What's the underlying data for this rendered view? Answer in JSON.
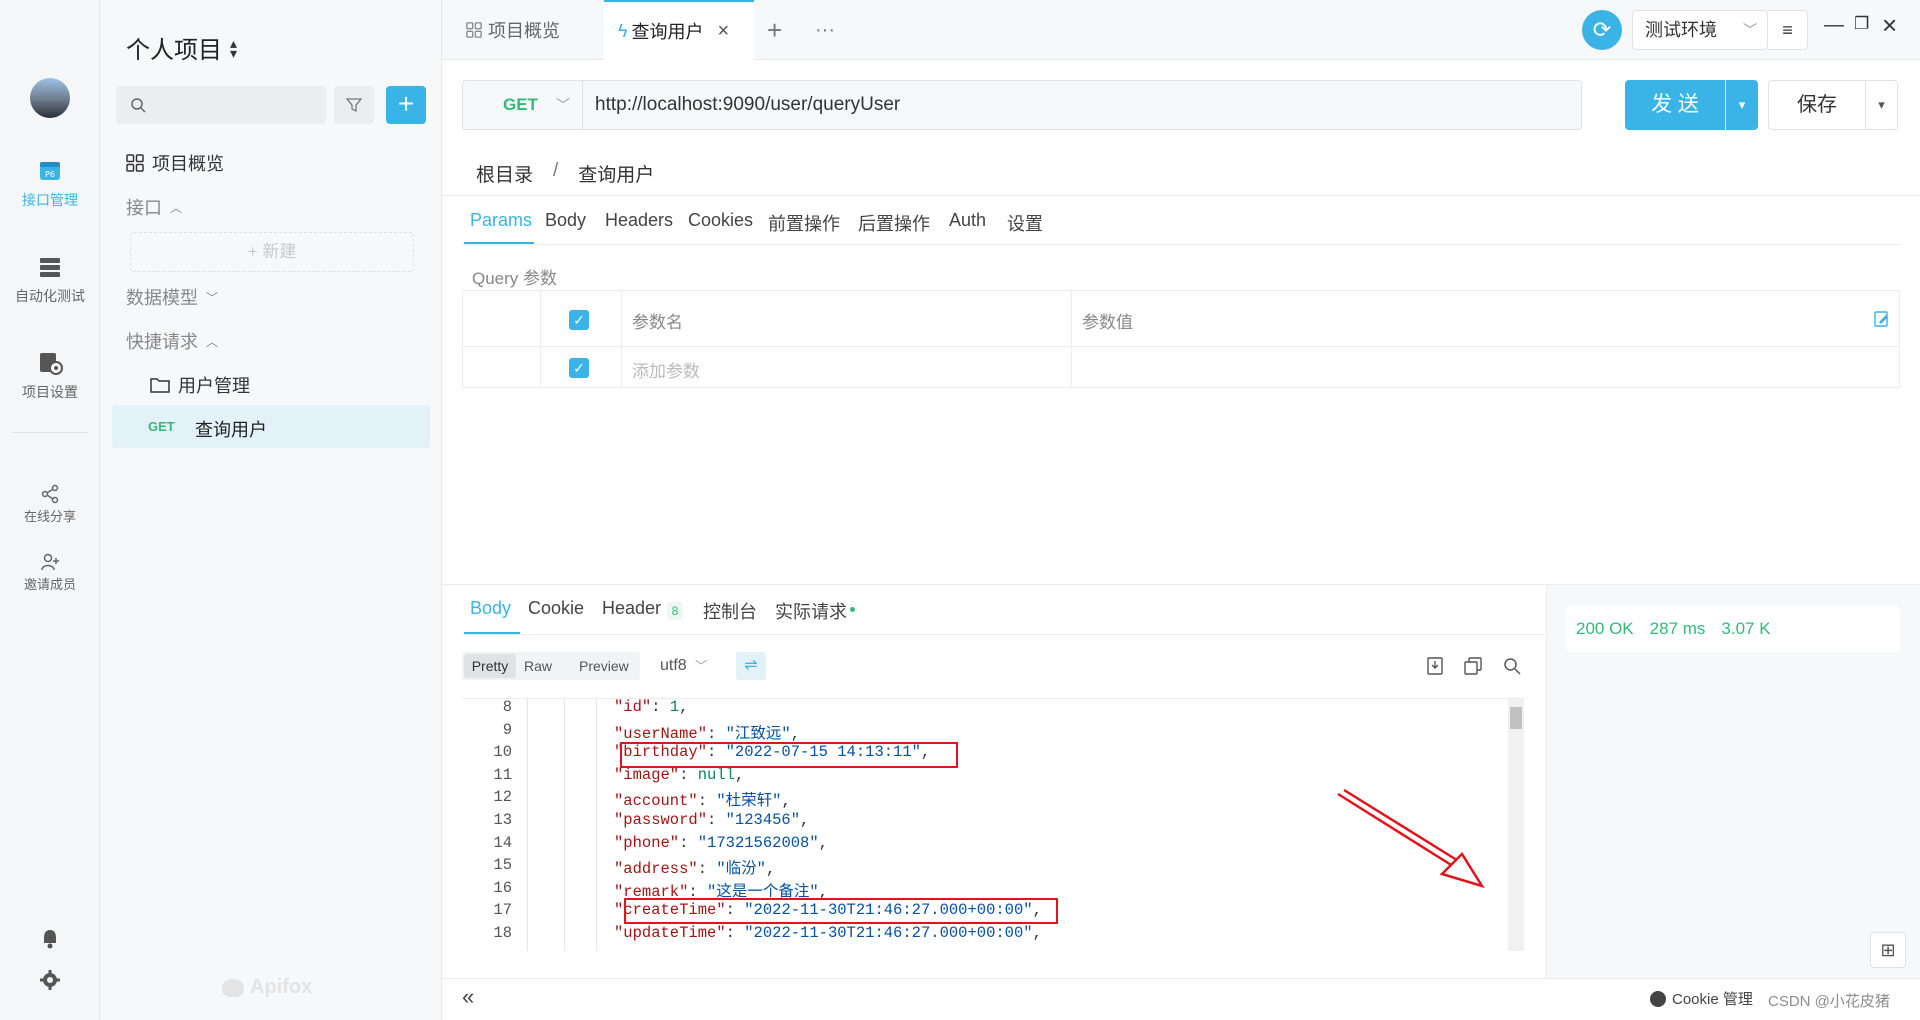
{
  "rail": {
    "items": [
      {
        "label": "接口管理"
      },
      {
        "label": "自动化测试"
      },
      {
        "label": "项目设置"
      },
      {
        "label": "在线分享"
      },
      {
        "label": "邀请成员"
      }
    ]
  },
  "sidebar": {
    "project_title": "个人项目",
    "overview": "项目概览",
    "api_section": "接口",
    "new_label": "+ 新建",
    "data_model": "数据模型",
    "quick_request": "快捷请求",
    "folder": "用户管理",
    "request_method": "GET",
    "request_name": "查询用户",
    "brand": "Apifox"
  },
  "tabs": {
    "overview": "项目概览",
    "active": "查询用户",
    "env": "测试环境"
  },
  "request": {
    "method": "GET",
    "url": "http://localhost:9090/user/queryUser",
    "send": "发 送",
    "save": "保存"
  },
  "breadcrumb": {
    "root": "根目录",
    "sep": "/",
    "current": "查询用户"
  },
  "req_tabs": [
    "Params",
    "Body",
    "Headers",
    "Cookies",
    "前置操作",
    "后置操作",
    "Auth",
    "设置"
  ],
  "query": {
    "title": "Query 参数",
    "col_name": "参数名",
    "col_value": "参数值",
    "add_placeholder": "添加参数"
  },
  "resp_tabs": {
    "body": "Body",
    "cookie": "Cookie",
    "header": "Header",
    "header_count": "8",
    "console": "控制台",
    "actual": "实际请求"
  },
  "resp_view": {
    "pretty": "Pretty",
    "raw": "Raw",
    "preview": "Preview",
    "encoding": "utf8"
  },
  "status": {
    "code": "200 OK",
    "time": "287 ms",
    "size": "3.07 K"
  },
  "code": [
    {
      "n": "8",
      "key": "\"id\"",
      "val": "1",
      "vt": "n"
    },
    {
      "n": "9",
      "key": "\"userName\"",
      "val": "\"江致远\"",
      "vt": "s"
    },
    {
      "n": "10",
      "key": "\"birthday\"",
      "val": "\"2022-07-15 14:13:11\"",
      "vt": "s"
    },
    {
      "n": "11",
      "key": "\"image\"",
      "val": "null",
      "vt": "n"
    },
    {
      "n": "12",
      "key": "\"account\"",
      "val": "\"杜荣轩\"",
      "vt": "s"
    },
    {
      "n": "13",
      "key": "\"password\"",
      "val": "\"123456\"",
      "vt": "s"
    },
    {
      "n": "14",
      "key": "\"phone\"",
      "val": "\"17321562008\"",
      "vt": "s"
    },
    {
      "n": "15",
      "key": "\"address\"",
      "val": "\"临汾\"",
      "vt": "s"
    },
    {
      "n": "16",
      "key": "\"remark\"",
      "val": "\"这是一个备注\"",
      "vt": "s"
    },
    {
      "n": "17",
      "key": "\"createTime\"",
      "val": "\"2022-11-30T21:46:27.000+00:00\"",
      "vt": "s"
    },
    {
      "n": "18",
      "key": "\"updateTime\"",
      "val": "\"2022-11-30T21:46:27.000+00:00\"",
      "vt": "s"
    }
  ],
  "footer": {
    "cookie_mgmt": "Cookie 管理",
    "watermark": "CSDN @小花皮猪"
  },
  "colors": {
    "accent": "#3ab4e6",
    "highlight_box": "#e0151b",
    "get": "#34b97a"
  }
}
